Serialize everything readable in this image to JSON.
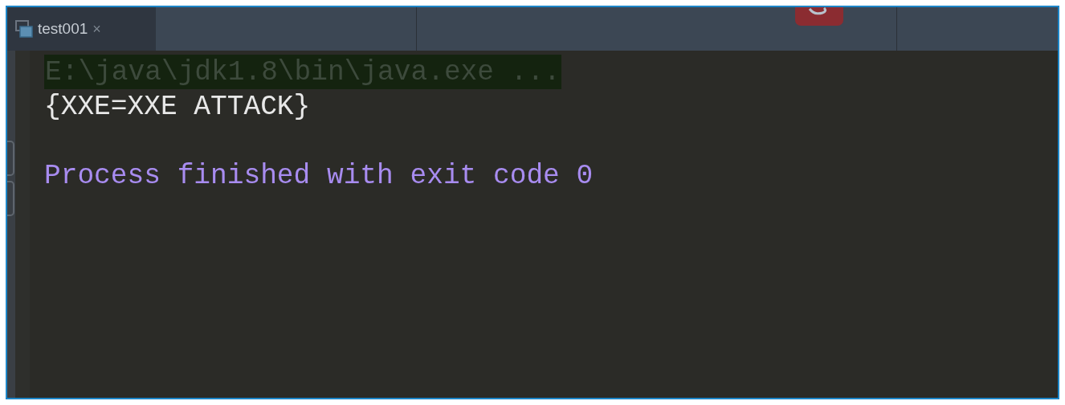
{
  "tabs": [
    {
      "label": "test001",
      "close": "×",
      "selected": true
    }
  ],
  "console": {
    "lines": [
      {
        "kind": "command",
        "text": "E:\\java\\jdk1.8\\bin\\java.exe ..."
      },
      {
        "kind": "output",
        "text": "{XXE=XXE ATTACK}"
      },
      {
        "kind": "blank"
      },
      {
        "kind": "system",
        "text": "Process finished with exit code 0"
      }
    ]
  }
}
